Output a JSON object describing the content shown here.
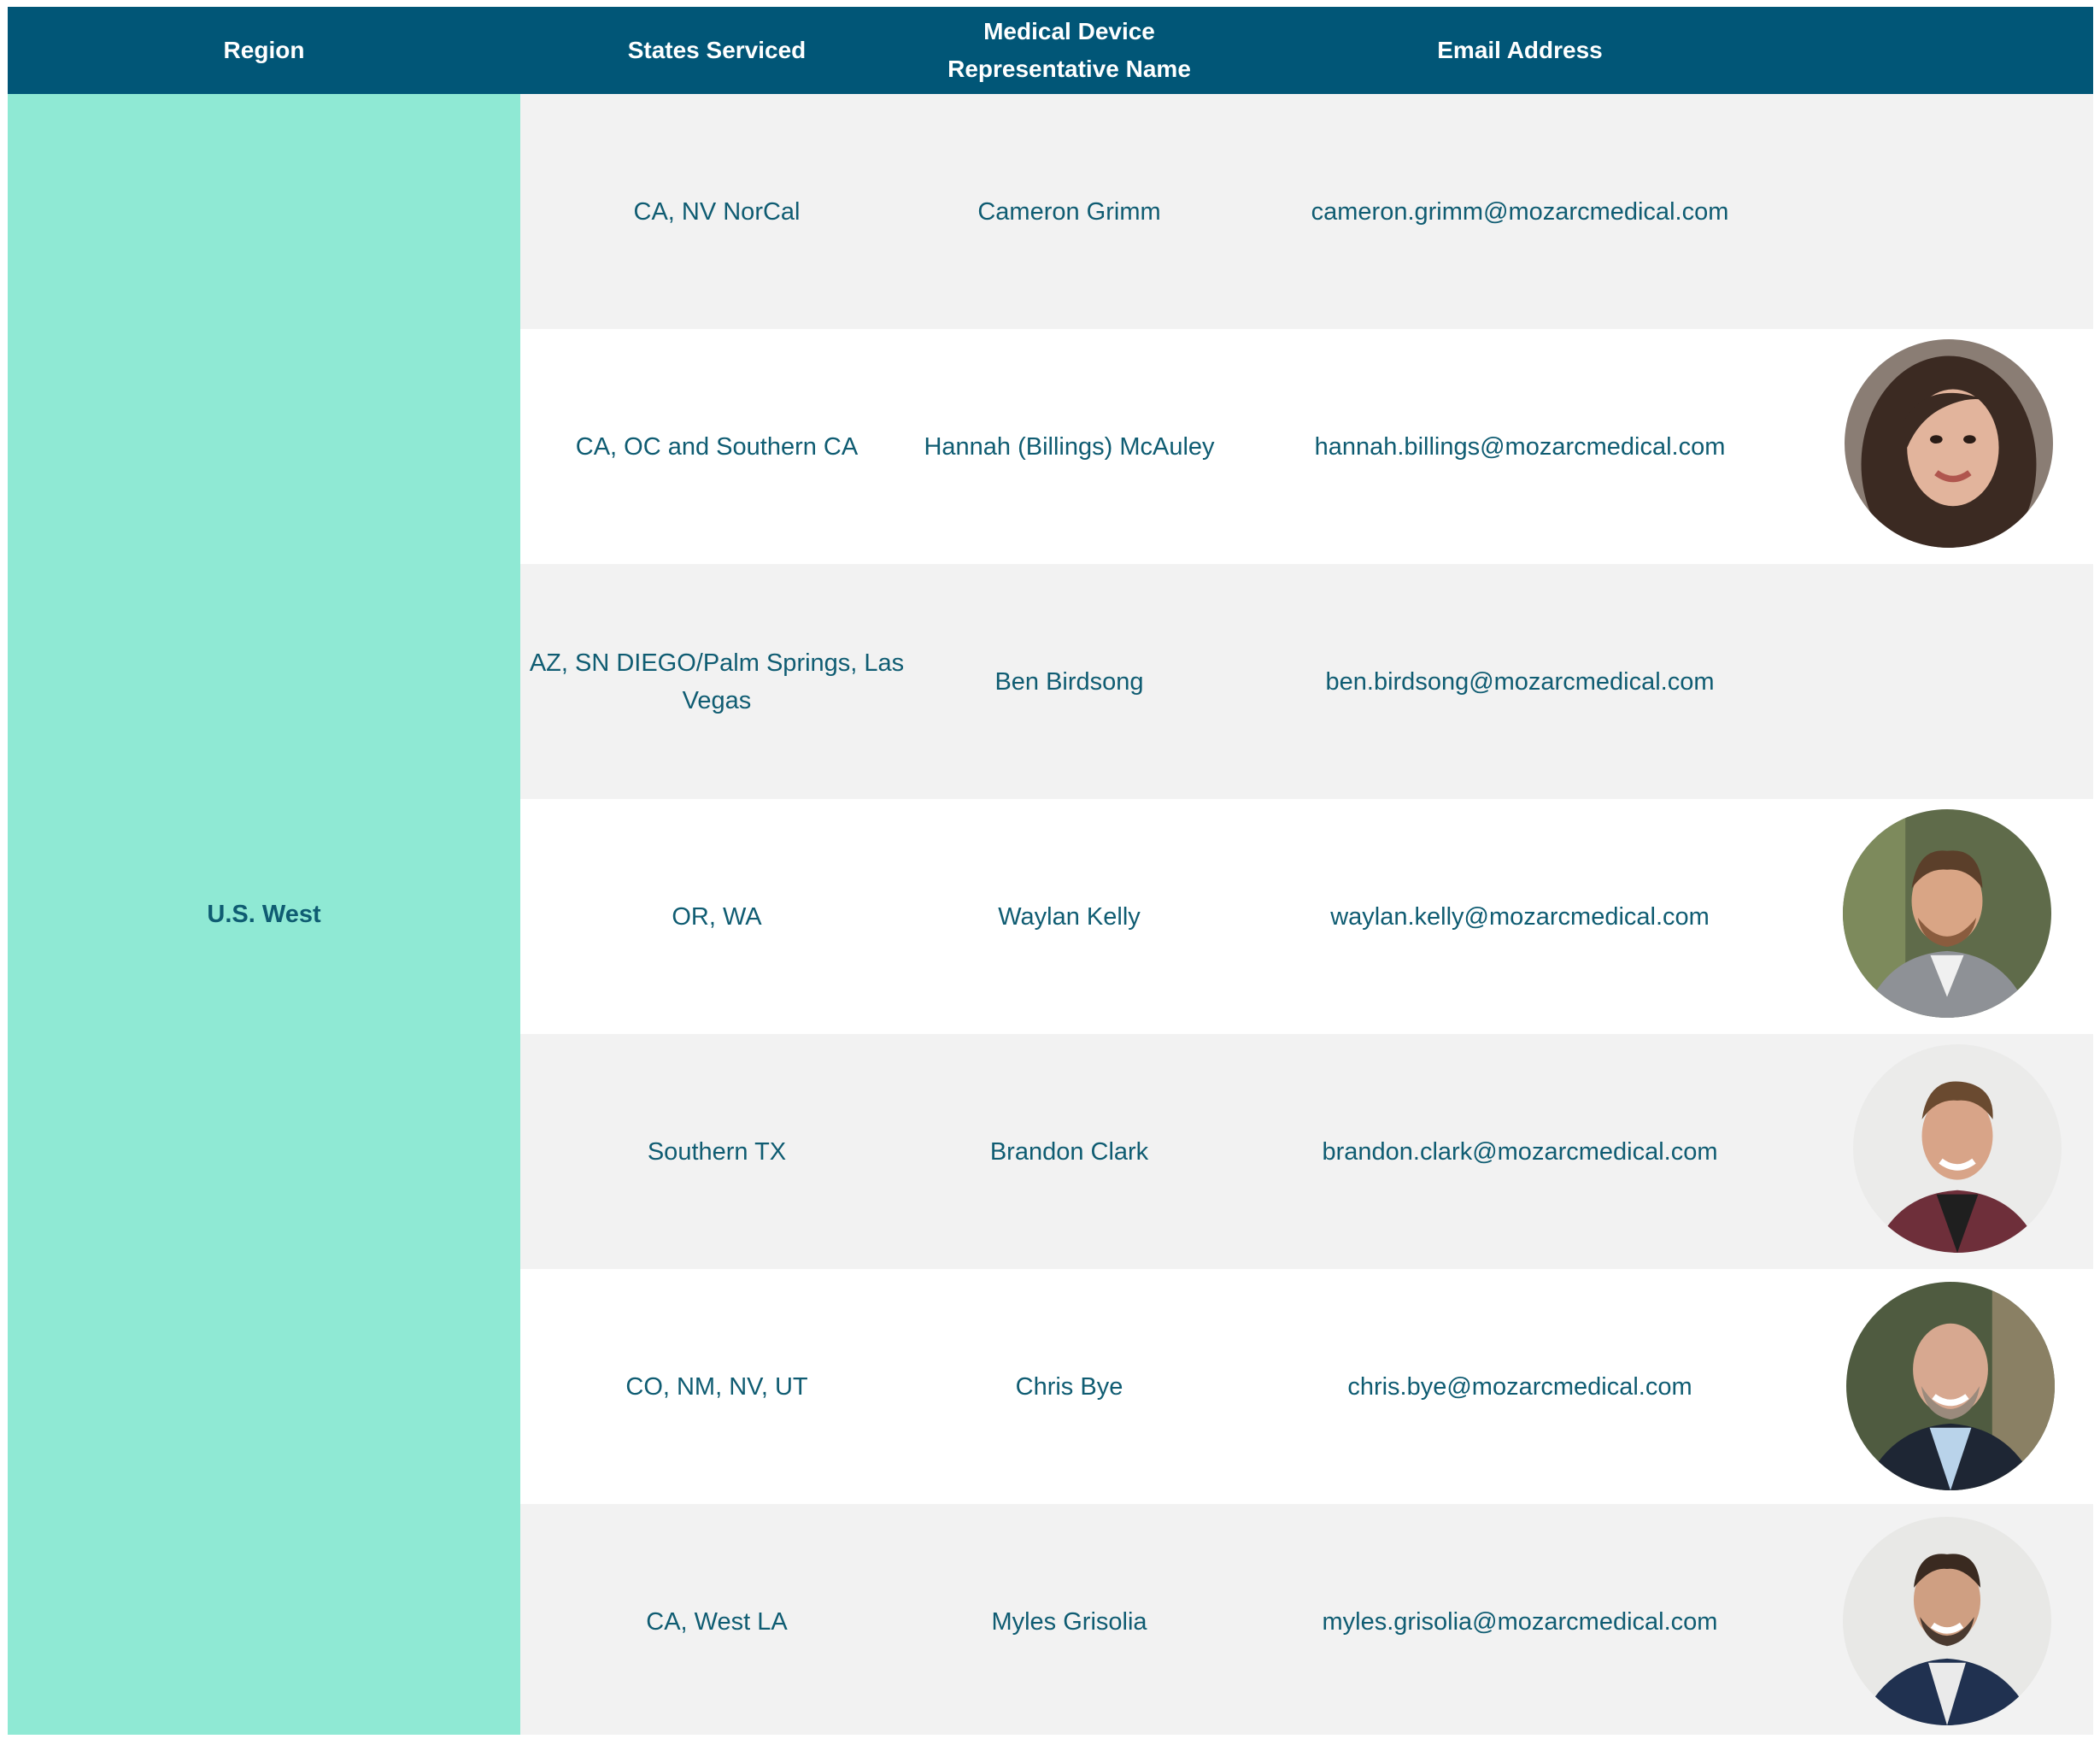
{
  "header": {
    "region": "Region",
    "states": "States Serviced",
    "rep_line1": "Medical Device",
    "rep_line2": "Representative Name",
    "email": "Email Address"
  },
  "region": "U.S. West",
  "colors": {
    "header_bg": "#015677",
    "region_bg": "#8fe9d4",
    "text": "#0f5c72",
    "row_alt": "#f2f2f2"
  },
  "rows": [
    {
      "states": "CA, NV NorCal",
      "name": "Cameron Grimm",
      "email": "cameron.grimm@mozarcmedical.com",
      "photo": false
    },
    {
      "states": "CA, OC and Southern CA",
      "name": "Hannah (Billings) McAuley",
      "email": "hannah.billings@mozarcmedical.com",
      "photo": true
    },
    {
      "states": "AZ, SN DIEGO/Palm Springs, Las Vegas",
      "name": "Ben Birdsong",
      "email": "ben.birdsong@mozarcmedical.com",
      "photo": false
    },
    {
      "states": "OR, WA",
      "name": "Waylan Kelly",
      "email": "waylan.kelly@mozarcmedical.com",
      "photo": true
    },
    {
      "states": "Southern TX",
      "name": "Brandon Clark",
      "email": "brandon.clark@mozarcmedical.com",
      "photo": true
    },
    {
      "states": "CO, NM, NV, UT",
      "name": "Chris Bye",
      "email": "chris.bye@mozarcmedical.com",
      "photo": true
    },
    {
      "states": "CA, West LA",
      "name": "Myles Grisolia",
      "email": "myles.grisolia@mozarcmedical.com",
      "photo": true
    }
  ]
}
